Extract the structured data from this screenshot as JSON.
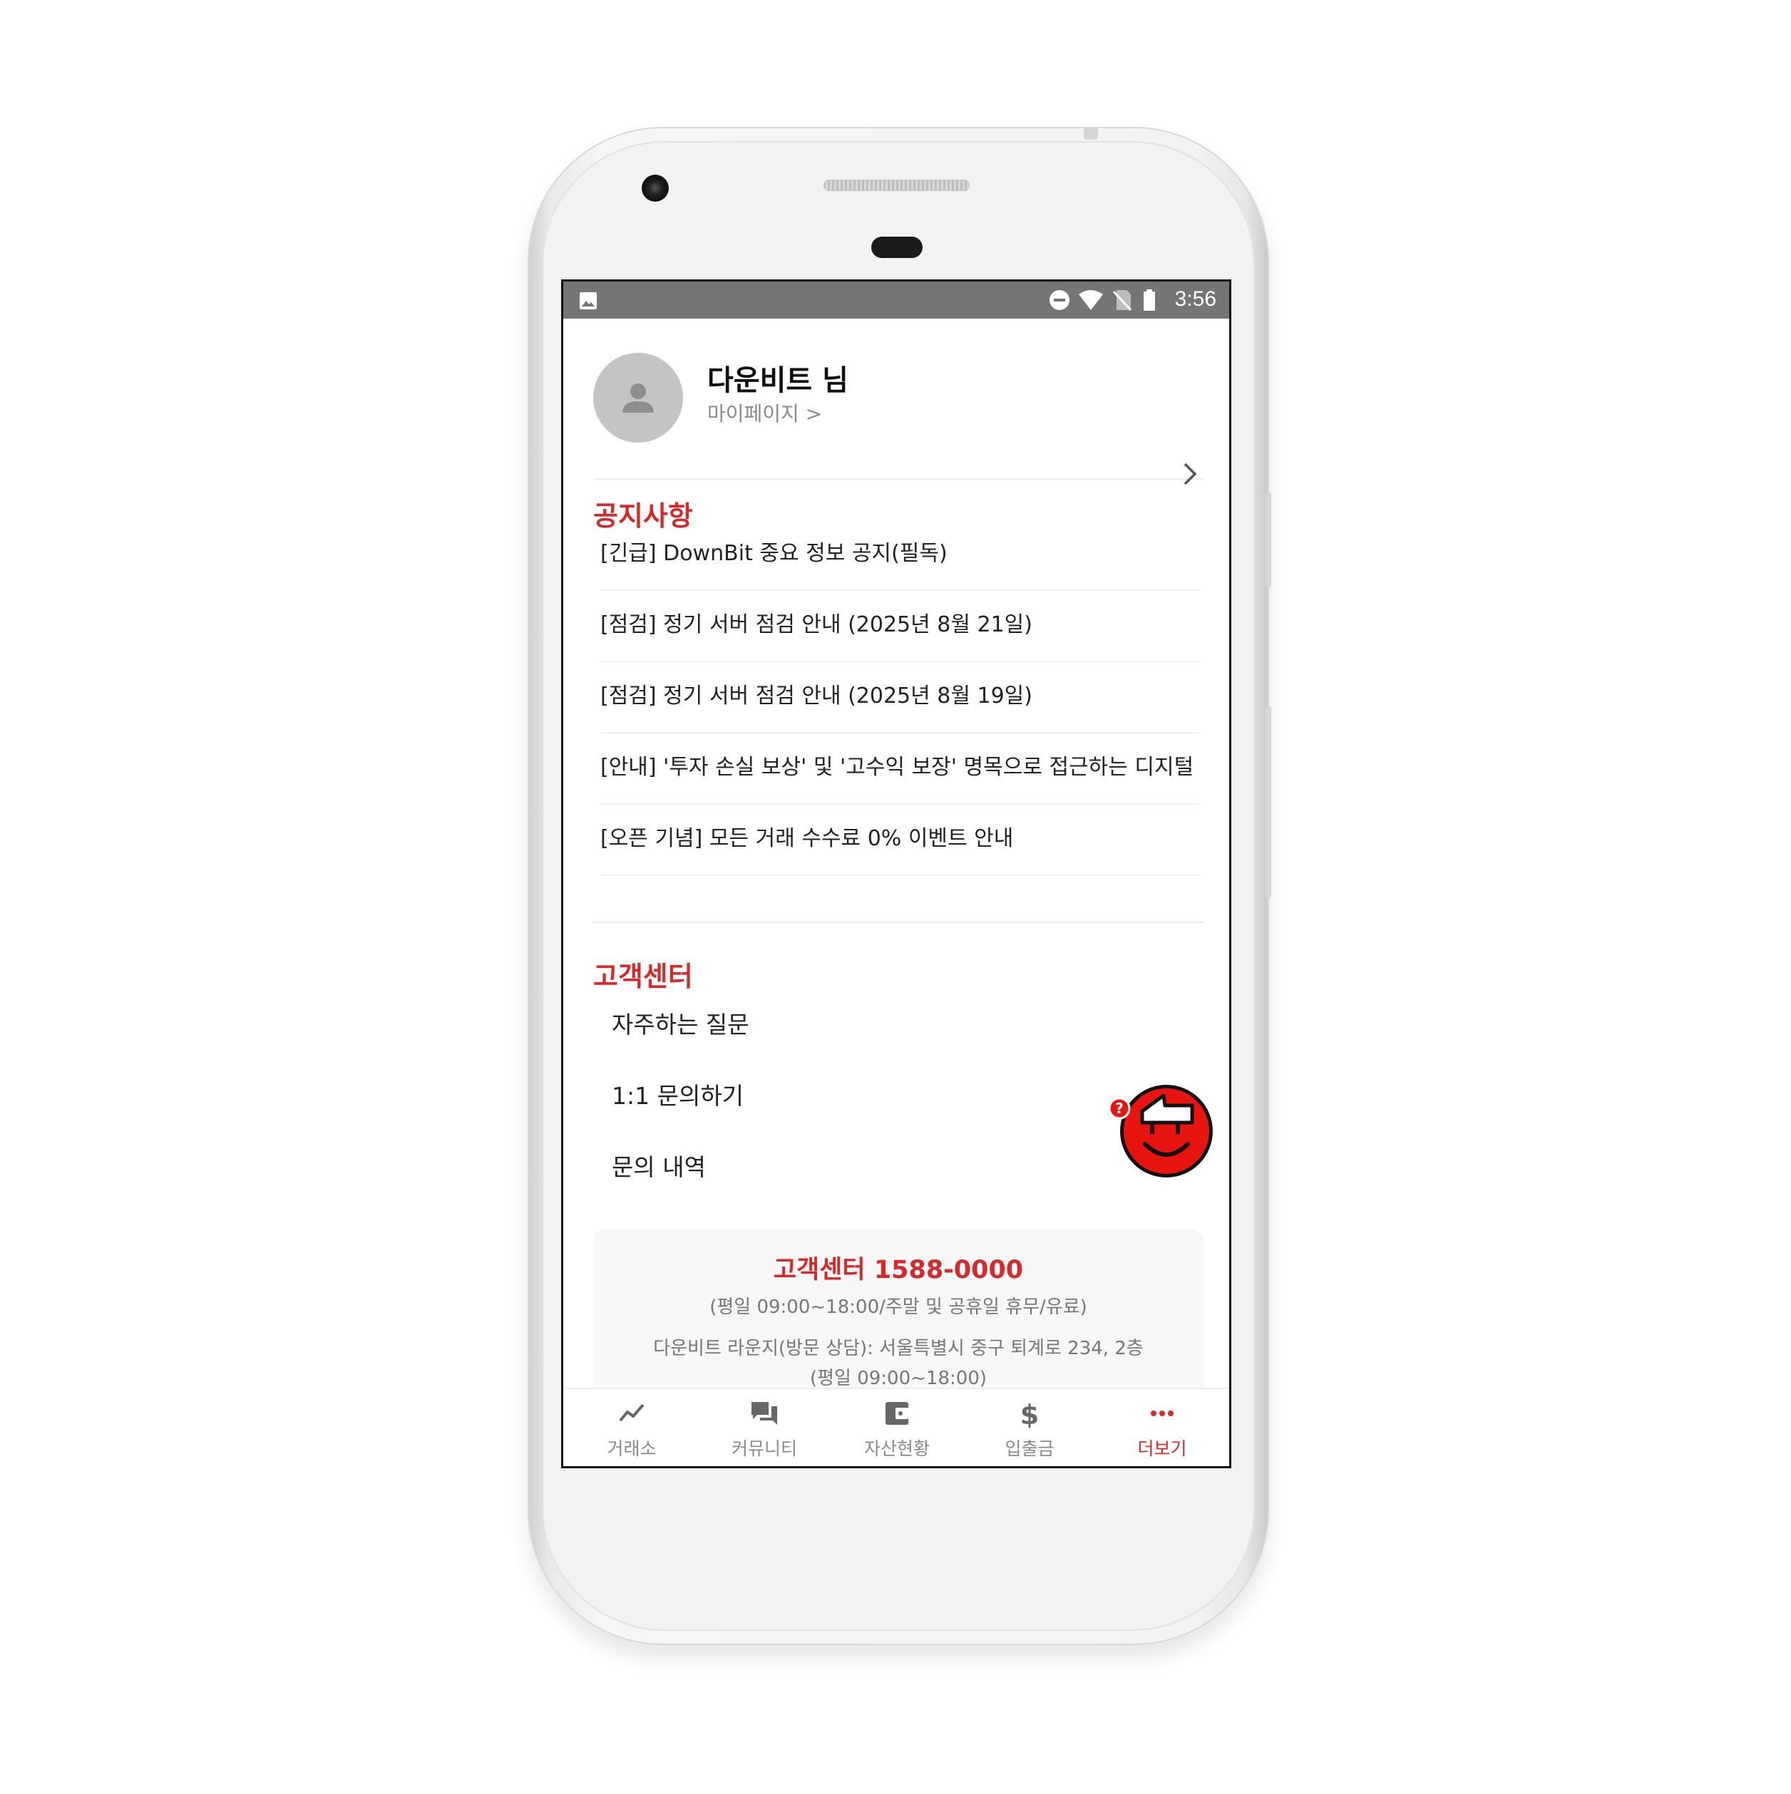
{
  "status_bar": {
    "time": "3:56"
  },
  "profile": {
    "name": "다운비트 님",
    "mypage_link": "마이페이지 >"
  },
  "notices": {
    "title": "공지사항",
    "items": [
      "[긴급] DownBit 중요 정보 공지(필독)",
      "[점검] 정기 서버 점검 안내 (2025년 8월 21일)",
      "[점검] 정기 서버 점검 안내 (2025년 8월 19일)",
      "[안내] '투자 손실 보상' 및 '고수익 보장' 명목으로 접근하는 디지털",
      "[오픈 기념] 모든 거래 수수료 0% 이벤트 안내"
    ]
  },
  "customer_center": {
    "title": "고객센터",
    "items": [
      "자주하는 질문",
      "1:1 문의하기",
      "문의 내역"
    ],
    "phone": "고객센터 1588-0000",
    "hours": "(평일 09:00~18:00/주말 및 공휴일 휴무/유료)",
    "lounge": "다운비트 라운지(방문 상담): 서울특별시 중구 퇴계로 234, 2층",
    "lounge_hours": "(평일 09:00~18:00)"
  },
  "fab": {
    "badge": "?"
  },
  "bottom_nav": {
    "items": [
      {
        "label": "거래소",
        "icon": "trend-icon"
      },
      {
        "label": "커뮤니티",
        "icon": "chat-icon"
      },
      {
        "label": "자산현황",
        "icon": "wallet-icon"
      },
      {
        "label": "입출금",
        "icon": "dollar-icon"
      },
      {
        "label": "더보기",
        "icon": "more-icon"
      }
    ],
    "active_index": 4
  },
  "colors": {
    "accent": "#d62a2a",
    "status_bar": "#757575"
  }
}
